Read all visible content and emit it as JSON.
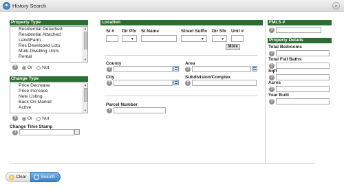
{
  "window": {
    "title": "History Search",
    "close_glyph": "×"
  },
  "property_type": {
    "header": "Property Type",
    "items": [
      "Residential Detached",
      "Residential Attached",
      "Land/Farm",
      "Res Developed Lots",
      "Multi-Dwelling Units",
      "Rental"
    ],
    "or_label": "Or",
    "not_label": "Not"
  },
  "change_type": {
    "header": "Change Type",
    "items": [
      "Price Decrease",
      "Price Increase",
      "New Listing",
      "Back On Market",
      "Active"
    ],
    "or_label": "Or",
    "not_label": "Not"
  },
  "change_time_stamp": {
    "label": "Change Time Stamp"
  },
  "location": {
    "header": "Location",
    "st_num": "St #",
    "dir_pfx": "Dir Pfx",
    "st_name": "St Name",
    "street_suffix": "Street Suffix",
    "dir_sfx": "Dir Sfx",
    "unit": "Unit #",
    "more_button": "More",
    "county": "County",
    "area": "Area",
    "city": "City",
    "subdivision": "Subdivision/Complex",
    "parcel": "Parcel Number"
  },
  "fmls": {
    "header": "FMLS #"
  },
  "property_details": {
    "header": "Property Details",
    "bedrooms": "Total Bedrooms",
    "baths": "Total Full Baths",
    "sqft": "Sqft",
    "acres": "Acres",
    "year_built": "Year Built"
  },
  "help_glyph": "?",
  "buttons": {
    "clear": "Clear",
    "search": "Search"
  },
  "colors": {
    "section_header": "#2b6e31",
    "search_button": "#3c82c4"
  }
}
